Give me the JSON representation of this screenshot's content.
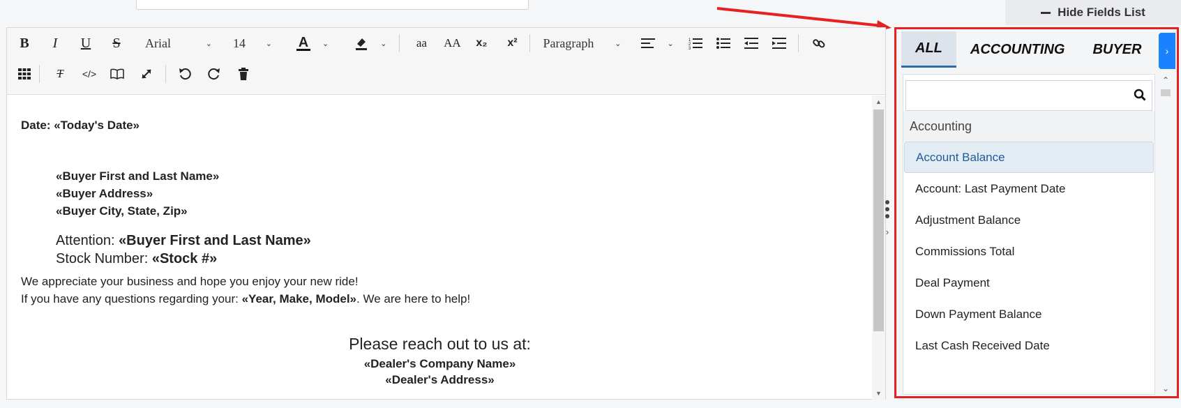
{
  "header": {
    "hide_fields_label": "Hide Fields List"
  },
  "toolbar": {
    "bold": "B",
    "italic": "I",
    "underline": "U",
    "strike": "S",
    "font_family": "Arial",
    "font_size": "14",
    "font_color": "A",
    "lowercase": "aa",
    "uppercase": "AA",
    "subscript": "x₂",
    "superscript": "x²",
    "paragraph": "Paragraph",
    "clear_format": "T"
  },
  "document": {
    "date_line": "Date: «Today's Date»",
    "addr_name": "«Buyer First and Last Name»",
    "addr_address": "«Buyer Address»",
    "addr_city": "«Buyer City, State, Zip»",
    "attn_label": "Attention: ",
    "attn_value": "«Buyer First and Last Name»",
    "stock_label": "Stock Number: ",
    "stock_value": "«Stock #»",
    "line1": "We appreciate your business and hope you enjoy your new ride!",
    "line2_pre": "If you have any questions regarding your: ",
    "line2_field": "«Year, Make, Model»",
    "line2_post": ". We are here to help!",
    "reach": "Please reach out to us at:",
    "company": "«Dealer's Company Name»",
    "address": "«Dealer's Address»"
  },
  "fields_panel": {
    "tabs": [
      {
        "label": "ALL",
        "active": true
      },
      {
        "label": "ACCOUNTING",
        "active": false
      },
      {
        "label": "BUYER",
        "active": false
      }
    ],
    "search_placeholder": "",
    "group": "Accounting",
    "items": [
      "Account Balance",
      "Account: Last Payment Date",
      "Adjustment Balance",
      "Commissions Total",
      "Deal Payment",
      "Down Payment Balance",
      "Last Cash Received Date"
    ],
    "selected_index": 0
  },
  "colors": {
    "highlight_border": "#e52222",
    "tab_next": "#1a82ff",
    "selected_text": "#1e5c99"
  }
}
